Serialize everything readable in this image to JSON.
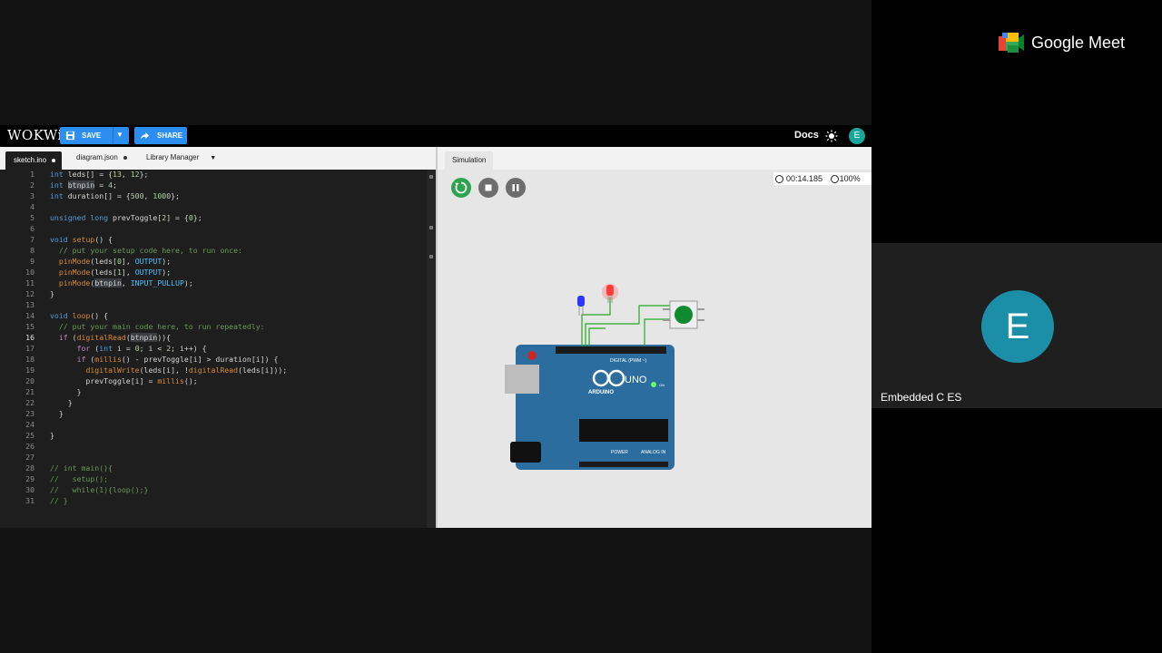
{
  "wokwi": {
    "logo": "WOKWi",
    "save_label": "SAVE",
    "share_label": "SHARE",
    "docs_label": "Docs",
    "user_initial": "E"
  },
  "editor_tabs": [
    {
      "label": "sketch.ino"
    },
    {
      "label": "diagram.json"
    },
    {
      "label": "Library Manager"
    }
  ],
  "code": {
    "line_numbers": [
      "1",
      "2",
      "3",
      "4",
      "5",
      "6",
      "7",
      "8",
      "9",
      "10",
      "11",
      "12",
      "13",
      "14",
      "15",
      "16",
      "17",
      "18",
      "19",
      "20",
      "21",
      "22",
      "23",
      "24",
      "25",
      "26",
      "27",
      "28",
      "29",
      "30",
      "31"
    ],
    "current_line": "16"
  },
  "simulation": {
    "tab_label": "Simulation",
    "timer": "00:14.185",
    "speed": "100%"
  },
  "board_labels": {
    "name": "UNO",
    "brand": "ARDUINO",
    "digital": "DIGITAL (PWM ~)",
    "analog": "ANALOG IN",
    "power": "POWER",
    "on": "ON"
  },
  "meet": {
    "title": "Google Meet",
    "participant_initial": "E",
    "participant_name": "Embedded C ES"
  },
  "colors": {
    "wokwi_blue": "#2b8ef0",
    "board_blue": "#2b6d9e",
    "avatar_teal": "#1b8fa8",
    "play_green": "#2ea44f"
  }
}
